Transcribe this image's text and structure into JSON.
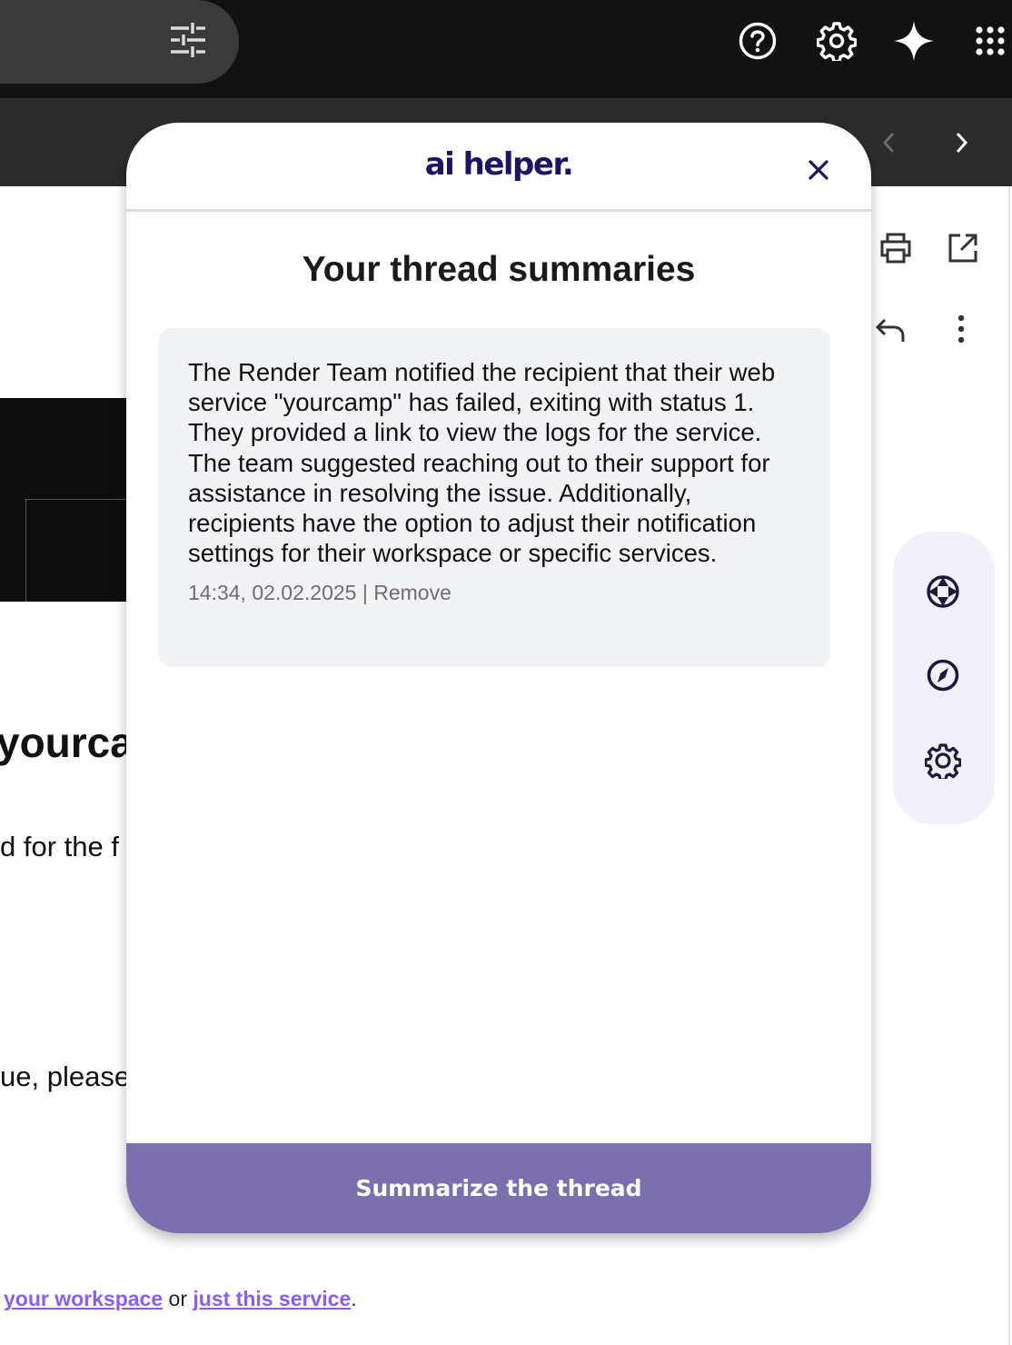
{
  "topbar": {
    "icons": [
      "tune-icon",
      "help-icon",
      "settings-icon",
      "sparkle-icon",
      "apps-grid-icon"
    ]
  },
  "nav": {
    "icons": [
      "chevron-left-icon",
      "chevron-right-icon"
    ]
  },
  "email": {
    "heading_fragment": "yourca",
    "line_fragment_1": "d for the f",
    "line_fragment_2": "ue, please",
    "footer_link_1": "your workspace",
    "footer_or": "or",
    "footer_link_2": "just this service",
    "footer_period": "."
  },
  "email_toolbar": {
    "icons": [
      "print-icon",
      "open-in-new-icon",
      "reply-icon",
      "more-vert-icon"
    ]
  },
  "side_tools": {
    "icons": [
      "aperture-icon",
      "compass-icon",
      "gear-outline-icon"
    ]
  },
  "modal": {
    "logo": "ai helper.",
    "title": "Your thread summaries",
    "summaries": [
      {
        "text": "The Render Team notified the recipient that their web service \"yourcamp\" has failed, exiting with status 1. They provided a link to view the logs for the service. The team suggested reaching out to their support for assistance in resolving the issue. Additionally, recipients have the option to adjust their notification settings for their workspace or specific services.",
        "timestamp": "14:34, 02.02.2025",
        "separator": "|",
        "remove_label": "Remove"
      }
    ],
    "summarize_label": "Summarize the thread"
  },
  "colors": {
    "topbar_bg": "#121212",
    "subbar_bg": "#2c2c2c",
    "brand_navy": "#1e1466",
    "button_purple": "#7b70ad",
    "link_purple": "#8d5cf6",
    "card_bg": "#f2f3f5",
    "tool_panel_bg": "#f1f0fb"
  }
}
